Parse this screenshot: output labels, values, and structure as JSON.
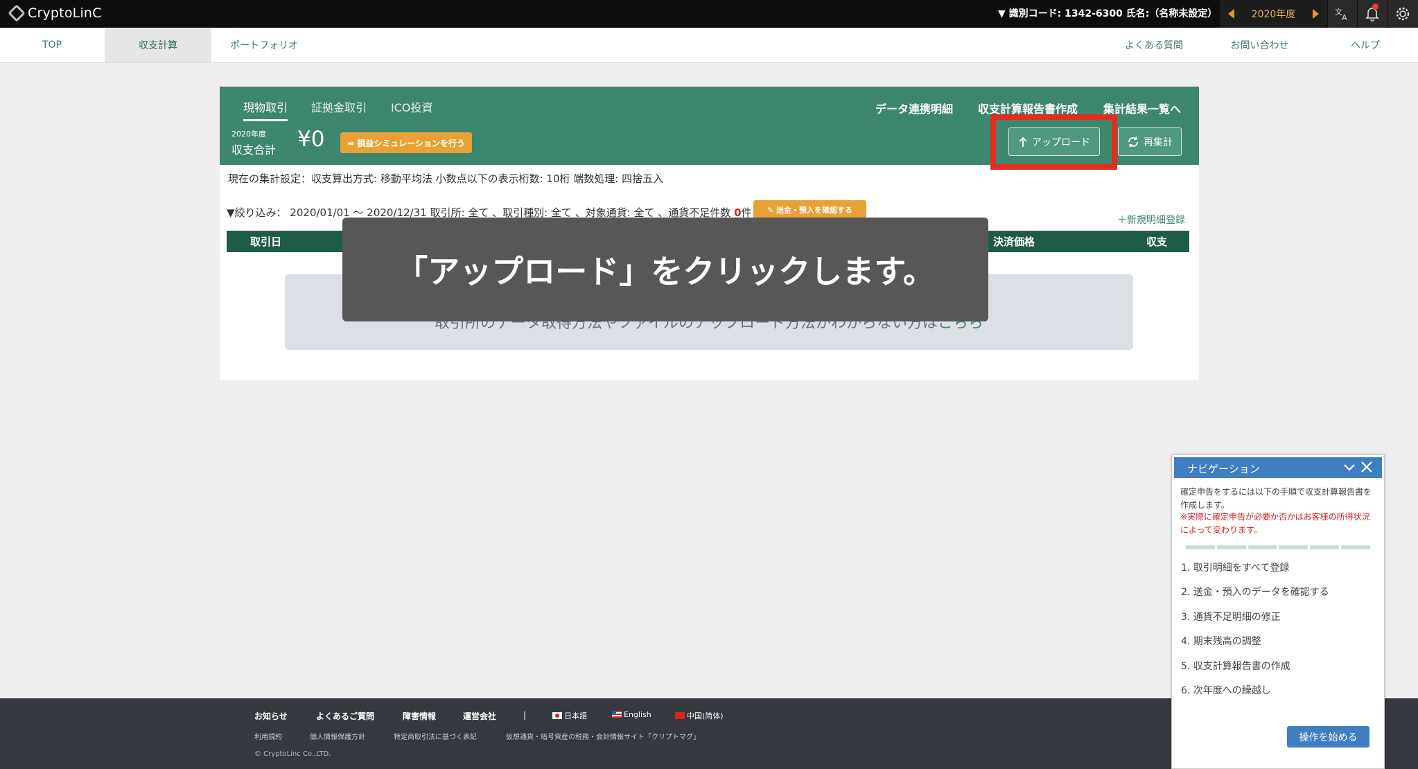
{
  "topbar": {
    "logo": "CryptoLinC",
    "id_info": "▼ 識別コード: 1342-6300  氏名:（名称未設定）",
    "year": "2020年度"
  },
  "nav": {
    "items": [
      "TOP",
      "収支計算",
      "ポートフォリオ"
    ],
    "right": [
      "よくある質問",
      "お問い合わせ",
      "ヘルプ"
    ]
  },
  "panel": {
    "tabs": [
      "現物取引",
      "証拠金取引",
      "ICO投資"
    ],
    "links": [
      "データ連携明細",
      "収支計算報告書作成",
      "集計結果一覧へ"
    ],
    "total_year": "2020年度",
    "total_label": "収支合計",
    "total_amount": "¥0",
    "sim_button": "➡ 損益シミュレーションを行う",
    "upload_button": "アップロード",
    "recalc_button": "再集計",
    "settings": "現在の集計設定：収支算出方式: 移動平均法  小数点以下の表示桁数: 10桁  端数処理: 四捨五入",
    "filter_prefix": "▼絞り込み：  2020/01/01 〜 2020/12/31 取引所: 全て 、取引種別: 全て 、対象通貨: 全て 、通貨不足件数 ",
    "filter_count": "0",
    "filter_suffix": "件",
    "confirm_button": "✎ 送金・預入を確認する",
    "new_entry": "＋新規明細登録",
    "table_headers": [
      "取引日",
      "決済価格",
      "収支"
    ],
    "empty_text": "取引所のデータ取得方法やファイルのアップロード方法がわからない方は",
    "empty_link": "こちら"
  },
  "callout": {
    "text": "「アップロード」をクリックします。"
  },
  "footer": {
    "row1": [
      "お知らせ",
      "よくあるご質問",
      "障害情報",
      "運営会社",
      "|",
      "日本語",
      "English",
      "中国(简体)"
    ],
    "row2": [
      "利用規約",
      "個人情報保護方針",
      "特定商取引法に基づく表記",
      "仮想通貨・暗号資産の税務・会計情報サイト「クリプトマグ」"
    ],
    "copyright": "© CryptoLinc Co.,LTD."
  },
  "navigation": {
    "title": "ナビゲーション",
    "description": "確定申告をするには以下の手順で収支計算報告書を作成します。",
    "warning": "※実際に確定申告が必要か否かはお客様の所得状況によって変わります。",
    "steps": [
      "1. 取引明細をすべて登録",
      "2. 送金・預入のデータを確認する",
      "3. 通貨不足明細の修正",
      "4. 期末残高の調整",
      "5. 収支計算報告書の作成",
      "6. 次年度への繰越し"
    ],
    "start_button": "操作を始める"
  },
  "colors": {
    "brand_green": "#3c876d",
    "dark_green": "#1f5c47",
    "highlight_red": "#e12d1f",
    "accent_orange": "#e7a134",
    "nav_blue": "#3f7fc1"
  }
}
